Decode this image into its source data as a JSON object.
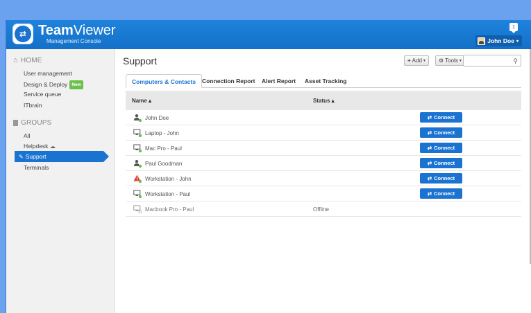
{
  "app": {
    "brand_bold": "Team",
    "brand_light": "Viewer",
    "brand_sub": "Management Console",
    "notification_count": "1",
    "user_name": "John Doe"
  },
  "sidebar": {
    "home_label": "HOME",
    "home_items": [
      {
        "label": "User management"
      },
      {
        "label": "Design & Deploy",
        "badge": "New"
      },
      {
        "label": "Service queue"
      },
      {
        "label": "ITbrain"
      }
    ],
    "groups_label": "GROUPS",
    "group_items": [
      {
        "label": "All"
      },
      {
        "label": "Helpdesk"
      },
      {
        "label": "Support",
        "active": true
      },
      {
        "label": "Terminals"
      }
    ]
  },
  "main": {
    "title": "Support",
    "add_label": "Add",
    "tools_label": "Tools",
    "search_placeholder": "",
    "tabs": [
      {
        "label": "Computers & Contacts",
        "active": true
      },
      {
        "label": "Connection Report"
      },
      {
        "label": "Alert Report"
      },
      {
        "label": "Asset Tracking"
      }
    ],
    "columns": {
      "name": "Name ▴",
      "status": "Status ▴"
    },
    "connect_label": "Connect",
    "rows": [
      {
        "name": "John Doe",
        "type": "contact",
        "status": "",
        "online": true
      },
      {
        "name": "Laptop - John",
        "type": "computer",
        "status": "",
        "online": true
      },
      {
        "name": "Mac Pro - Paul",
        "type": "computer",
        "status": "",
        "online": true
      },
      {
        "name": "Paul Goodman",
        "type": "contact",
        "status": "",
        "online": true
      },
      {
        "name": "Workstation - John",
        "type": "alert",
        "status": "",
        "online": true
      },
      {
        "name": "Workstation - Paul",
        "type": "computer",
        "status": "",
        "online": true
      },
      {
        "name": "Macbook Pro - Paul",
        "type": "computer",
        "status": "Offline",
        "online": false
      }
    ]
  },
  "colors": {
    "accent": "#1a73d1",
    "online": "#6cc04a",
    "alert": "#e03a2f"
  }
}
